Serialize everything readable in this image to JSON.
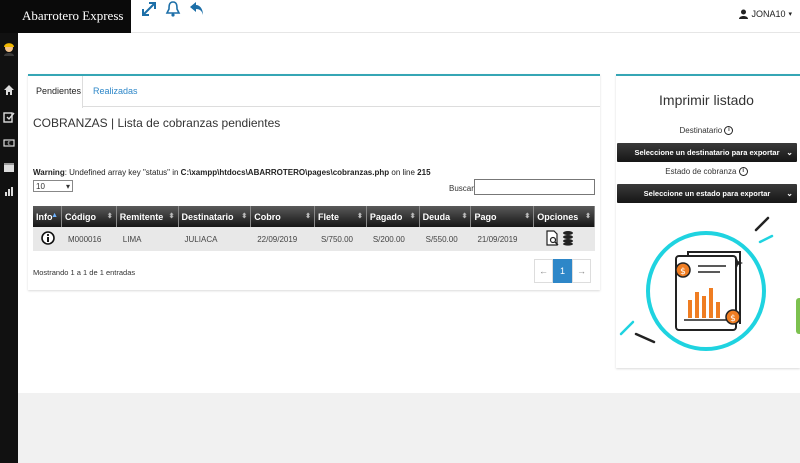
{
  "app": {
    "brand": "Abarrotero Express"
  },
  "user": {
    "name": "JONA10"
  },
  "tabs": [
    {
      "label": "Pendientes",
      "active": true
    },
    {
      "label": "Realizadas",
      "active": false
    }
  ],
  "panel": {
    "title": "COBRANZAS | Lista de cobranzas pendientes",
    "warning_label": "Warning",
    "warning_text_1": ": Undefined array key \"status\" in ",
    "warning_path": "C:\\xampp\\htdocs\\ABARROTERO\\pages\\cobranzas.php",
    "warning_text_2": " on line ",
    "warning_line": "215",
    "page_length": "10",
    "search_label": "Buscar:",
    "search_value": ""
  },
  "table": {
    "headers": [
      "Info",
      "Código",
      "Remitente",
      "Destinatario",
      "Cobro",
      "Flete",
      "Pagado",
      "Deuda",
      "Pago",
      "Opciones"
    ],
    "rows": [
      {
        "codigo": "M000016",
        "remitente": "LIMA",
        "destinatario": "JULIACA",
        "cobro": "22/09/2019",
        "flete": "S/750.00",
        "pagado": "S/200.00",
        "deuda": "S/550.00",
        "pago": "21/09/2019"
      }
    ],
    "summary": "Mostrando 1 a 1 de 1 entradas"
  },
  "pagination": {
    "prev": "←",
    "current": "1",
    "next": "→"
  },
  "print_panel": {
    "title": "Imprimir listado",
    "destinatario_label": "Destinatario",
    "destinatario_select": "Seleccione un destinatario para exportar",
    "estado_label": "Estado de cobranza",
    "estado_select": "Seleccione un estado para exportar"
  },
  "colors": {
    "accent": "#36a6b5",
    "link": "#2e87c8",
    "illustration_ring": "#1fd3e0",
    "illustration_bars": "#ef7d22"
  }
}
